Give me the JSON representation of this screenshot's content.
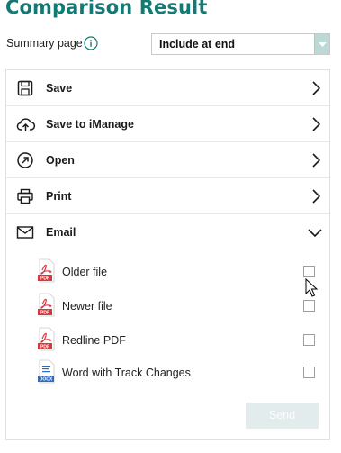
{
  "title": "Comparison Result",
  "summary": {
    "label": "Summary page",
    "select_value": "Include at end"
  },
  "menu": [
    {
      "label": "Save",
      "icon": "save-icon"
    },
    {
      "label": "Save to iManage",
      "icon": "cloud-upload-icon"
    },
    {
      "label": "Open",
      "icon": "open-arrow-icon"
    },
    {
      "label": "Print",
      "icon": "printer-icon"
    },
    {
      "label": "Email",
      "icon": "mail-icon"
    }
  ],
  "email_files": [
    {
      "label": "Older file",
      "icon": "pdf-file-icon",
      "checked": false
    },
    {
      "label": "Newer file",
      "icon": "pdf-file-icon",
      "checked": false
    },
    {
      "label": "Redline PDF",
      "icon": "pdf-file-icon",
      "checked": false
    },
    {
      "label": "Word with Track Changes",
      "icon": "docx-file-icon",
      "checked": false
    }
  ],
  "send_label": "Send",
  "colors": {
    "accent": "#127a73",
    "pdf_red": "#d9363e",
    "docx_blue": "#2b6cc4",
    "disabled_button": "#e3ecec"
  }
}
